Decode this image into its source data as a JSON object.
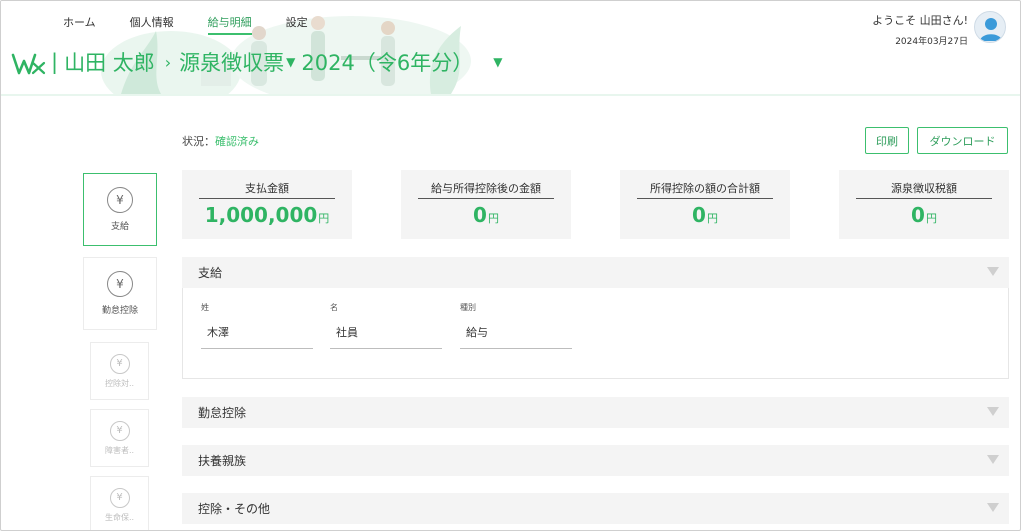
{
  "nav": {
    "items": [
      {
        "label": "ホーム",
        "active": false
      },
      {
        "label": "個人情報",
        "active": false
      },
      {
        "label": "給与明細",
        "active": true
      },
      {
        "label": "設定",
        "active": false
      }
    ]
  },
  "header": {
    "user_name": "山田 太郎",
    "document": "源泉徴収票",
    "year": "2024（令6年分）",
    "welcome": "ようこそ 山田さん!",
    "date": "2024年03月27日"
  },
  "status": {
    "label": "状況：",
    "value": "確認済み"
  },
  "buttons": {
    "print": "印刷",
    "download": "ダウンロード"
  },
  "sidebar": {
    "items": [
      {
        "label": "支給",
        "symbol": "¥"
      },
      {
        "label": "勤怠控除",
        "symbol": "¥"
      },
      {
        "label": "控除対..",
        "symbol": "¥"
      },
      {
        "label": "障害者..",
        "symbol": "¥"
      },
      {
        "label": "生命保..",
        "symbol": "¥"
      }
    ]
  },
  "cards": [
    {
      "title": "支払金額",
      "value": "1,000,000",
      "unit": "円"
    },
    {
      "title": "給与所得控除後の金額",
      "value": "0",
      "unit": "円"
    },
    {
      "title": "所得控除の額の合計額",
      "value": "0",
      "unit": "円"
    },
    {
      "title": "源泉徴収税額",
      "value": "0",
      "unit": "円"
    }
  ],
  "sections": [
    {
      "title": "支給"
    },
    {
      "title": "勤怠控除"
    },
    {
      "title": "扶養親族"
    },
    {
      "title": "控除・その他"
    }
  ],
  "fields": [
    {
      "label": "姓",
      "value": "木澤"
    },
    {
      "label": "名",
      "value": "社員"
    },
    {
      "label": "種別",
      "value": "給与"
    }
  ],
  "colors": {
    "accent": "#3cbf6e",
    "accent_text": "#2fb463",
    "card_bg": "#f4f4f4"
  }
}
